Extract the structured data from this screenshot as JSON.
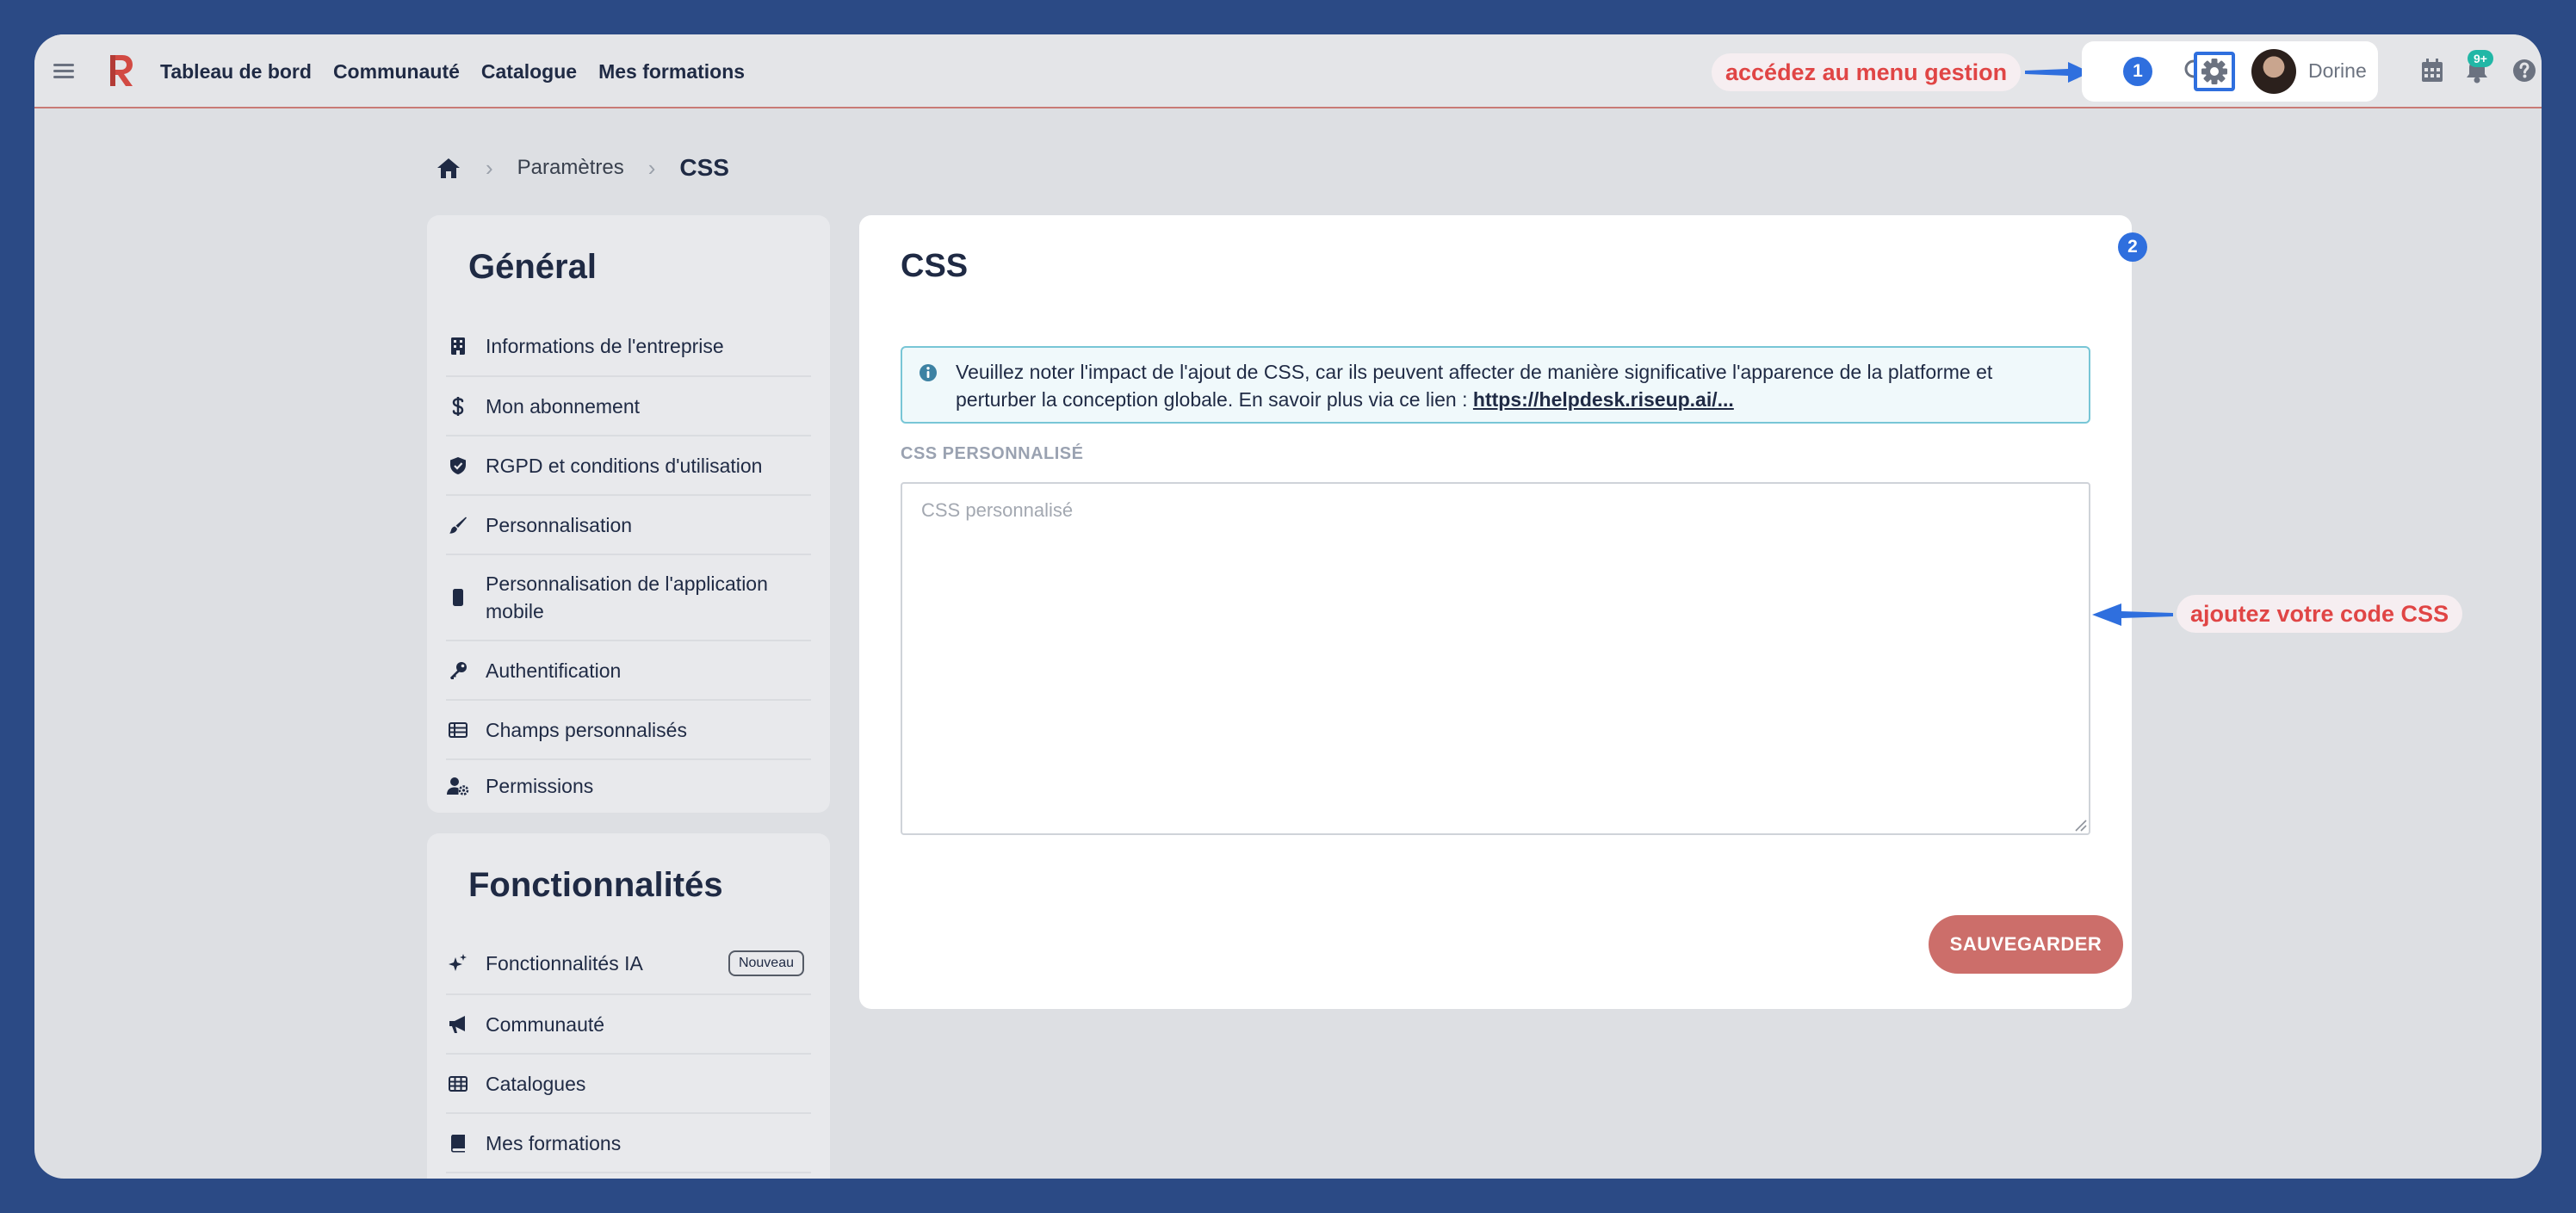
{
  "topbar": {
    "nav": [
      "Tableau de bord",
      "Communauté",
      "Catalogue",
      "Mes formations"
    ],
    "user_name": "Dorine",
    "notification_count": "9+",
    "step_badge": "1"
  },
  "annotations": {
    "menu_callout": "accédez au menu gestion",
    "code_callout": "ajoutez votre code CSS",
    "card_badge": "2",
    "accent_color": "#2f6fde",
    "callout_text_color": "#e04545"
  },
  "breadcrumb": {
    "items": [
      "Paramètres",
      "CSS"
    ]
  },
  "sidebar": {
    "general": {
      "title": "Général",
      "items": [
        {
          "label": "Informations de l'entreprise",
          "icon": "building-icon"
        },
        {
          "label": "Mon abonnement",
          "icon": "dollar-icon"
        },
        {
          "label": "RGPD et conditions d'utilisation",
          "icon": "shield-icon"
        },
        {
          "label": "Personnalisation",
          "icon": "brush-icon"
        },
        {
          "label": "Personnalisation de l'application mobile",
          "icon": "mobile-icon"
        },
        {
          "label": "Authentification",
          "icon": "key-icon"
        },
        {
          "label": "Champs personnalisés",
          "icon": "list-table-icon"
        },
        {
          "label": "Permissions",
          "icon": "user-gear-icon"
        }
      ]
    },
    "features": {
      "title": "Fonctionnalités",
      "new_tag": "Nouveau",
      "items": [
        {
          "label": "Fonctionnalités IA",
          "icon": "sparkles-icon"
        },
        {
          "label": "Communauté",
          "icon": "megaphone-icon"
        },
        {
          "label": "Catalogues",
          "icon": "grid-table-icon"
        },
        {
          "label": "Mes formations",
          "icon": "book-icon"
        }
      ]
    }
  },
  "main": {
    "title": "CSS",
    "info_text": "Veuillez noter l'impact de l'ajout de CSS, car ils peuvent affecter de manière significative l'apparence de la platforme et perturber la conception globale. En savoir plus via ce lien : ",
    "info_link": "https://helpdesk.riseup.ai/...",
    "field_label": "CSS PERSONNALISÉ",
    "field_placeholder": "CSS personnalisé",
    "field_value": "",
    "save_label": "SAUVEGARDER",
    "save_color": "#cc6e6a"
  }
}
